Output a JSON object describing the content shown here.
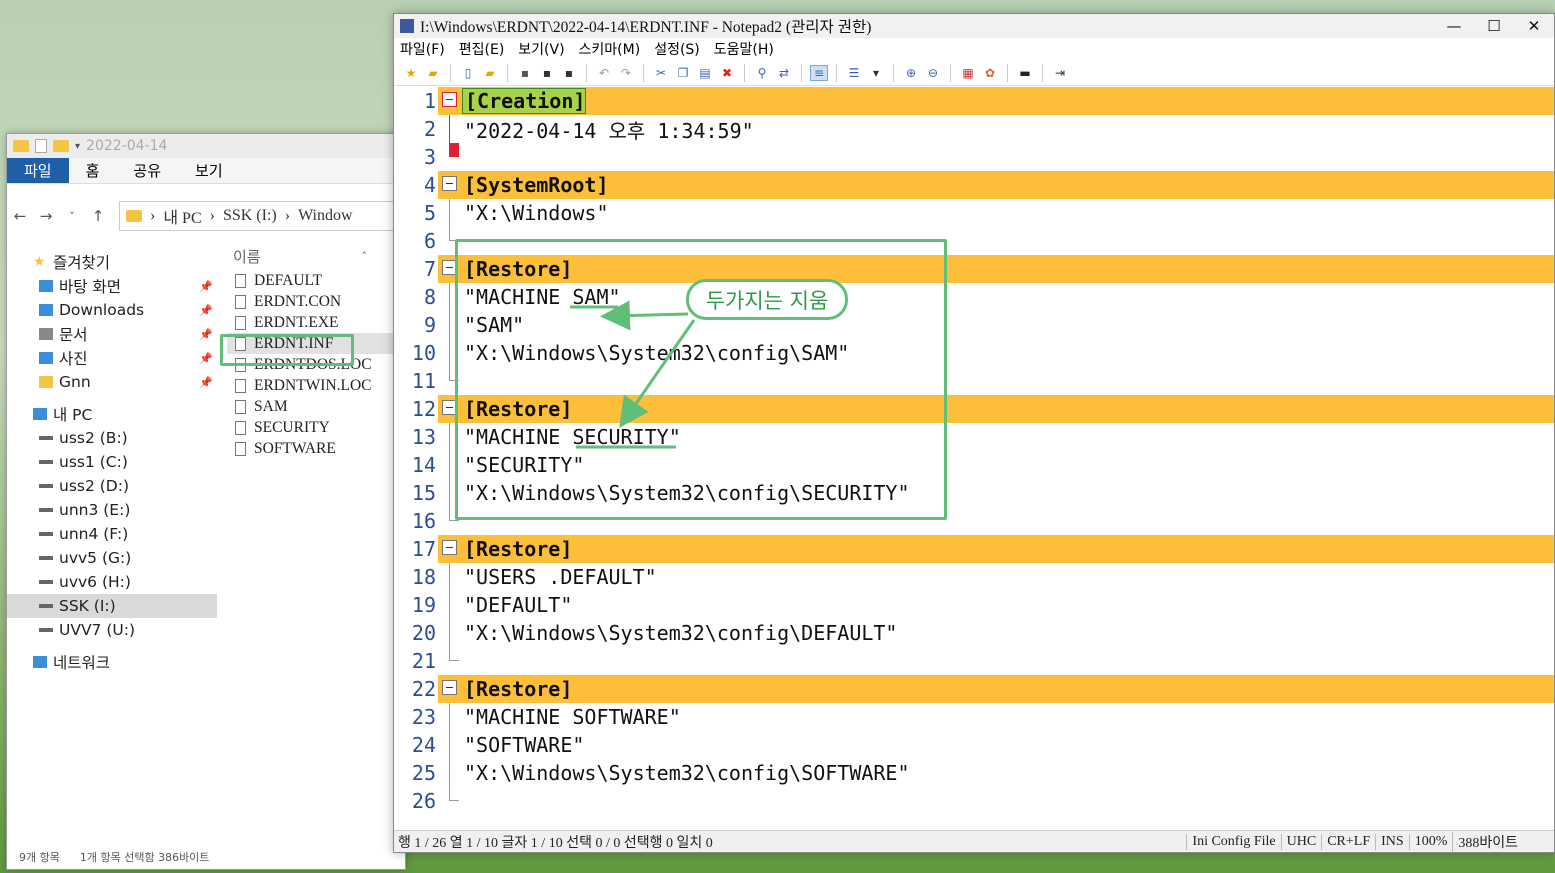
{
  "explorer": {
    "title": "2022-04-14",
    "ribbon_tabs": [
      "파일",
      "홈",
      "공유",
      "보기"
    ],
    "breadcrumb": [
      "내 PC",
      "SSK (I:)",
      "Window"
    ],
    "nav": [
      {
        "label": "즐겨찾기",
        "icon": "star-icon",
        "pinned": false,
        "indent": 1
      },
      {
        "label": "바탕 화면",
        "icon": "desktop-icon",
        "pinned": true,
        "indent": 2
      },
      {
        "label": "Downloads",
        "icon": "download-icon",
        "pinned": true,
        "indent": 2
      },
      {
        "label": "문서",
        "icon": "document-icon",
        "pinned": true,
        "indent": 2
      },
      {
        "label": "사진",
        "icon": "pictures-icon",
        "pinned": true,
        "indent": 2
      },
      {
        "label": "Gnn",
        "icon": "folder-icon",
        "pinned": true,
        "indent": 2
      },
      {
        "label": "내 PC",
        "icon": "pc-icon",
        "pinned": false,
        "indent": 1
      },
      {
        "label": "uss2 (B:)",
        "icon": "drive-icon",
        "pinned": false,
        "indent": 2
      },
      {
        "label": "uss1 (C:)",
        "icon": "drive-icon",
        "pinned": false,
        "indent": 2
      },
      {
        "label": "uss2 (D:)",
        "icon": "drive-icon",
        "pinned": false,
        "indent": 2
      },
      {
        "label": "unn3 (E:)",
        "icon": "drive-icon",
        "pinned": false,
        "indent": 2
      },
      {
        "label": "unn4 (F:)",
        "icon": "drive-icon",
        "pinned": false,
        "indent": 2
      },
      {
        "label": "uvv5 (G:)",
        "icon": "drive-icon",
        "pinned": false,
        "indent": 2
      },
      {
        "label": "uvv6 (H:)",
        "icon": "drive-icon",
        "pinned": false,
        "indent": 2
      },
      {
        "label": "SSK (I:)",
        "icon": "drive-icon",
        "pinned": false,
        "indent": 2,
        "selected": true
      },
      {
        "label": "UVV7 (U:)",
        "icon": "drive-icon",
        "pinned": false,
        "indent": 2
      },
      {
        "label": "네트워크",
        "icon": "network-icon",
        "pinned": false,
        "indent": 1
      }
    ],
    "column_header": "이름",
    "files": [
      "DEFAULT",
      "ERDNT.CON",
      "ERDNT.EXE",
      "ERDNT.INF",
      "ERDNTDOS.LOC",
      "ERDNTWIN.LOC",
      "SAM",
      "SECURITY",
      "SOFTWARE"
    ],
    "selected_file": "ERDNT.INF",
    "status_count": "9개 항목",
    "status_selection": "1개 항목 선택함 386바이트"
  },
  "notepad": {
    "title": "I:\\Windows\\ERDNT\\2022-04-14\\ERDNT.INF - Notepad2 (관리자 권한)",
    "menu": [
      "파일(F)",
      "편집(E)",
      "보기(V)",
      "스키마(M)",
      "설정(S)",
      "도움말(H)"
    ],
    "lines": [
      {
        "n": "1",
        "text": "[Creation]",
        "sec": true
      },
      {
        "n": "2",
        "text": "\"2022-04-14 오후 1:34:59\""
      },
      {
        "n": "3",
        "text": ""
      },
      {
        "n": "4",
        "text": "[SystemRoot]",
        "sec": true
      },
      {
        "n": "5",
        "text": "\"X:\\Windows\""
      },
      {
        "n": "6",
        "text": ""
      },
      {
        "n": "7",
        "text": "[Restore]",
        "sec": true
      },
      {
        "n": "8",
        "text": "\"MACHINE SAM\""
      },
      {
        "n": "9",
        "text": "\"SAM\""
      },
      {
        "n": "10",
        "text": "\"X:\\Windows\\System32\\config\\SAM\""
      },
      {
        "n": "11",
        "text": ""
      },
      {
        "n": "12",
        "text": "[Restore]",
        "sec": true
      },
      {
        "n": "13",
        "text": "\"MACHINE SECURITY\""
      },
      {
        "n": "14",
        "text": "\"SECURITY\""
      },
      {
        "n": "15",
        "text": "\"X:\\Windows\\System32\\config\\SECURITY\""
      },
      {
        "n": "16",
        "text": ""
      },
      {
        "n": "17",
        "text": "[Restore]",
        "sec": true
      },
      {
        "n": "18",
        "text": "\"USERS .DEFAULT\""
      },
      {
        "n": "19",
        "text": "\"DEFAULT\""
      },
      {
        "n": "20",
        "text": "\"X:\\Windows\\System32\\config\\DEFAULT\""
      },
      {
        "n": "21",
        "text": ""
      },
      {
        "n": "22",
        "text": "[Restore]",
        "sec": true
      },
      {
        "n": "23",
        "text": "\"MACHINE SOFTWARE\""
      },
      {
        "n": "24",
        "text": "\"SOFTWARE\""
      },
      {
        "n": "25",
        "text": "\"X:\\Windows\\System32\\config\\SOFTWARE\""
      },
      {
        "n": "26",
        "text": ""
      }
    ],
    "status": {
      "position": "행 1 / 26  열 1 / 10  글자 1 / 10  선택 0 / 0  선택행 0  일치 0",
      "scheme": "Ini Config File",
      "encoding": "UHC",
      "eol": "CR+LF",
      "mode": "INS",
      "zoom": "100%",
      "size": "388바이트"
    }
  },
  "annotation": {
    "callout": "두가지는 지움",
    "color": "#5fbf78"
  },
  "colors": {
    "section_bg": "#fdbe3a",
    "quote": "#b5651d",
    "ribbon_file": "#1f5fa8"
  }
}
